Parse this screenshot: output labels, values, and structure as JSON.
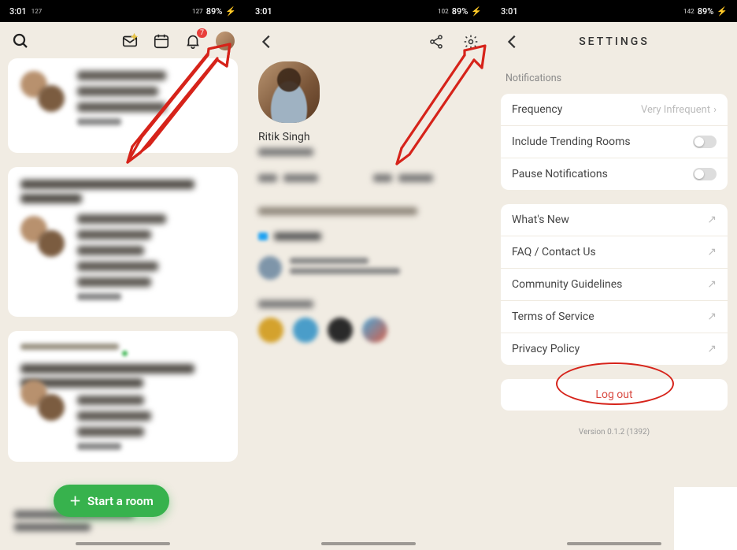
{
  "statusbar": {
    "time": "3:01",
    "battery": "89%",
    "net1": "127",
    "net2": "102",
    "net3": "142"
  },
  "screen1": {
    "notif_badge": "7",
    "fab_label": "Start a room"
  },
  "screen2": {
    "profile_name": "Ritik Singh"
  },
  "screen3": {
    "title": "SETTINGS",
    "section_notifications": "Notifications",
    "rows": {
      "frequency": "Frequency",
      "frequency_value": "Very Infrequent",
      "trending": "Include Trending Rooms",
      "pause": "Pause Notifications",
      "whatsnew": "What's New",
      "faq": "FAQ / Contact Us",
      "community": "Community Guidelines",
      "tos": "Terms of Service",
      "privacy": "Privacy Policy"
    },
    "logout": "Log out",
    "version": "Version 0.1.2 (1392)"
  }
}
